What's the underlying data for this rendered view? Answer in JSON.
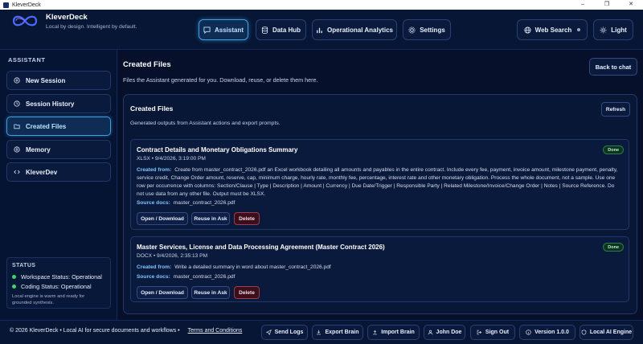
{
  "window": {
    "title": "KleverDeck",
    "minimize": "–",
    "maximize": "❐",
    "close": "✕"
  },
  "brand": {
    "name": "KleverDeck",
    "tagline": "Local by design. Intelligent by default."
  },
  "nav": {
    "assistant": "Assistant",
    "data_hub": "Data Hub",
    "operational_analytics": "Operational Analytics",
    "settings": "Settings",
    "web_search": "Web Search",
    "theme": "Light"
  },
  "sidebar": {
    "section_label": "ASSISTANT",
    "items": [
      {
        "label": "New Session"
      },
      {
        "label": "Session History"
      },
      {
        "label": "Created Files"
      },
      {
        "label": "Memory"
      },
      {
        "label": "KleverDev"
      }
    ],
    "status": {
      "title": "STATUS",
      "workspace": "Workspace Status: Operational",
      "coding": "Coding Status: Operational",
      "note": "Local engine is warm and ready for grounded synthesis."
    }
  },
  "main": {
    "title": "Created Files",
    "subtitle": "Files the Assistant generated for you. Download, reuse, or delete them here.",
    "back_button": "Back to chat",
    "panel": {
      "title": "Created Files",
      "subtitle": "Generated outputs from Assistant actions and export prompts.",
      "refresh": "Refresh"
    },
    "files": [
      {
        "title": "Contract Details and Monetary Obligations Summary",
        "meta": "XLSX • 9/4/2026, 3:19:00 PM",
        "badge": "Done",
        "created_from_label": "Created from:",
        "created_from": "Create from master_contract_2026.pdf an Excel workbook detailing all amounts and payables in the entire contract. Include every fee, payment, invoice amount, milestone payment, penalty, service credit, Change Order amount, reserve, cap, minimum charge, hourly rate, monthly fee, percentage, interest rate and other monetary obligation. Process the whole document, not a sample. Use one row per occurrence with columns: Section/Clause | Type | Description | Amount | Currency | Due Date/Trigger | Responsible Party | Related Milestone/Invoice/Change Order | Notes | Source Reference. Do not use data from any other file. Output must be XLSX.",
        "source_label": "Source docs:",
        "source": "master_contract_2026.pdf",
        "open": "Open / Download",
        "reuse": "Reuse in Ask",
        "delete": "Delete"
      },
      {
        "title": "Master Services, License and Data Processing Agreement (Master Contract 2026)",
        "meta": "DOCX • 9/4/2026, 2:35:13 PM",
        "badge": "Done",
        "created_from_label": "Created from:",
        "created_from": "Write a detailed summary in word about master_contract_2026.pdf",
        "source_label": "Source docs:",
        "source": "master_contract_2026.pdf",
        "open": "Open / Download",
        "reuse": "Reuse in Ask",
        "delete": "Delete"
      }
    ]
  },
  "footer": {
    "copyright": "© 2026 KleverDeck • Local AI for secure documents and workflows •",
    "terms": "Terms and Conditions",
    "send_logs": "Send Logs",
    "export_brain": "Export Brain",
    "import_brain": "Import Brain",
    "user": "John Doe",
    "sign_out": "Sign Out",
    "version": "Version 1.0.0",
    "engine": "Local AI Engine"
  },
  "colors": {
    "accent": "#3ea0e6",
    "status_ok": "#3fd56a",
    "danger": "#a33a4a",
    "background": "#06102a"
  }
}
